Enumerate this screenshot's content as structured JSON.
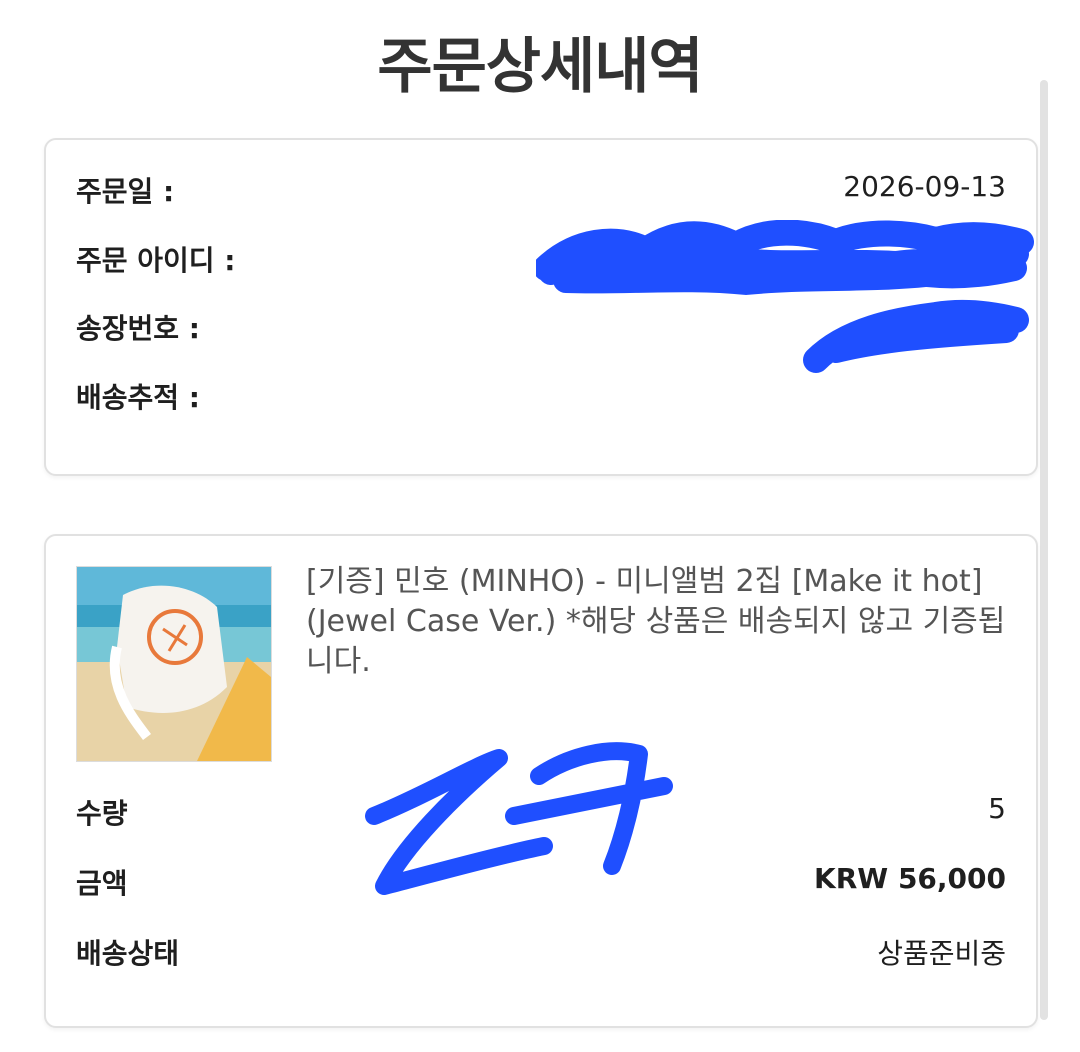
{
  "page": {
    "title": "주문상세내역"
  },
  "order_info": {
    "order_date_label": "주문일 :",
    "order_date_value": "2026-09-13",
    "order_id_label": "주문 아이디 :",
    "invoice_label": "송장번호 :",
    "tracking_label": "배송추적 :"
  },
  "product": {
    "name": "[기증] 민호 (MINHO) - 미니앨범 2집 [Make it hot] (Jewel Case Ver.) *해당 상품은 배송되지 않고 기증됩니다.",
    "quantity_label": "수량",
    "quantity_value": "5",
    "amount_label": "금액",
    "amount_value": "KRW 56,000",
    "status_label": "배송상태",
    "status_value": "상품준비중"
  },
  "colors": {
    "price": "#c62828",
    "redaction": "#1f4fff",
    "card_border": "#e1e1e1"
  }
}
